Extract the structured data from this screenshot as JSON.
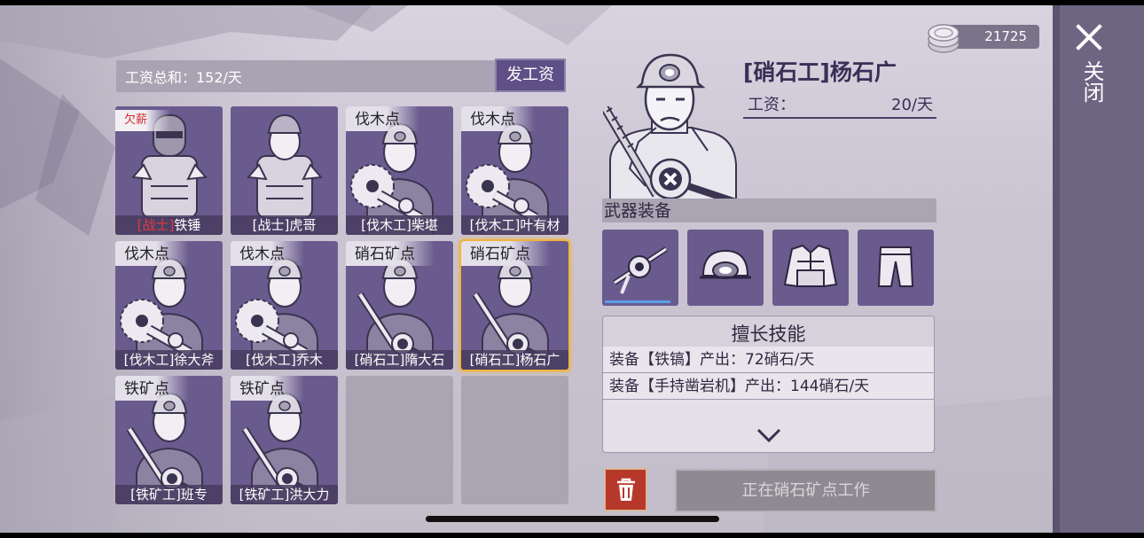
{
  "top": {
    "coins": "21725",
    "close_label": "关闭"
  },
  "roster": {
    "wage_total_label": "工资总和：152/天",
    "pay_button": "发工资",
    "cards": [
      {
        "loc": "",
        "badge": "欠薪",
        "role": "[战士]",
        "name": "铁锤",
        "role_red": true,
        "art": "warrior-helm"
      },
      {
        "loc": "",
        "badge": "",
        "role": "[战士]",
        "name": "虎哥",
        "role_red": false,
        "art": "warrior-cap"
      },
      {
        "loc": "伐木点",
        "badge": "",
        "role": "[伐木工]",
        "name": "柴堪",
        "role_red": false,
        "art": "saw"
      },
      {
        "loc": "伐木点",
        "badge": "",
        "role": "[伐木工]",
        "name": "叶有材",
        "role_red": false,
        "art": "saw"
      },
      {
        "loc": "伐木点",
        "badge": "",
        "role": "[伐木工]",
        "name": "徐大斧",
        "role_red": false,
        "art": "saw"
      },
      {
        "loc": "伐木点",
        "badge": "",
        "role": "[伐木工]",
        "name": "乔木",
        "role_red": false,
        "art": "saw"
      },
      {
        "loc": "硝石矿点",
        "badge": "",
        "role": "[硝石工]",
        "name": "隋大石",
        "role_red": false,
        "art": "drill"
      },
      {
        "loc": "硝石矿点",
        "badge": "",
        "role": "[硝石工]",
        "name": "杨石广",
        "role_red": false,
        "art": "drill",
        "selected": true
      },
      {
        "loc": "铁矿点",
        "badge": "",
        "role": "[铁矿工]",
        "name": "班专",
        "role_red": false,
        "art": "drill"
      },
      {
        "loc": "铁矿点",
        "badge": "",
        "role": "[铁矿工]",
        "name": "洪大力",
        "role_red": false,
        "art": "drill"
      },
      {
        "empty": true
      },
      {
        "empty": true
      }
    ]
  },
  "detail": {
    "title": "[硝石工]杨石广",
    "salary_label": "工资：",
    "salary_value": "20/天",
    "equipment_header": "武器装备",
    "equipment_slots": [
      "rock-drill-icon",
      "helmet-icon",
      "vest-icon",
      "pants-icon"
    ],
    "skills_title": "擅长技能",
    "skills": [
      "装备【铁镐】产出：72硝石/天",
      "装备【手持凿岩机】产出：144硝石/天"
    ],
    "work_status": "正在硝石矿点工作"
  }
}
